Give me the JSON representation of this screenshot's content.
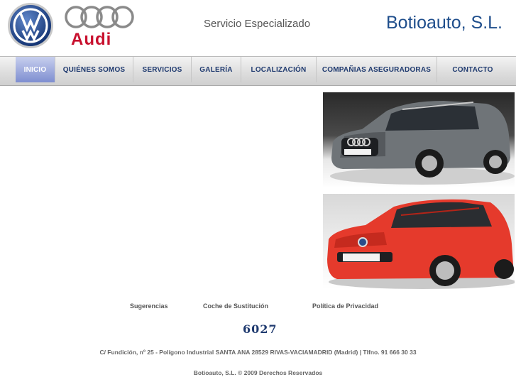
{
  "header": {
    "vw_logo": "vw-logo",
    "audi_logo_text": "Audi",
    "tagline": "Servicio Especializado",
    "brand": "Botioauto, S.L."
  },
  "nav": {
    "items": [
      {
        "label": "INICIO",
        "active": true
      },
      {
        "label": "QUIÉNES SOMOS",
        "active": false
      },
      {
        "label": "SERVICIOS",
        "active": false
      },
      {
        "label": "GALERÍA",
        "active": false
      },
      {
        "label": "LOCALIZACIÓN",
        "active": false
      },
      {
        "label": "COMPAÑIAS ASEGURADORAS",
        "active": false
      },
      {
        "label": "CONTACTO",
        "active": false
      }
    ]
  },
  "photos": {
    "top": "audi-car-photo",
    "bottom": "vw-car-photo"
  },
  "footer": {
    "links": {
      "sugerencias": "Sugerencias",
      "coche": "Coche de Sustitución",
      "privacidad": "Política de Privacidad"
    },
    "counter": "6027",
    "address": "C/ Fundición, nº 25 - Polígono Industrial SANTA ANA 28529 RIVAS-VACIAMADRID (Madrid) | Tlfno. 91 666 30 33",
    "copyright": "Botioauto, S.L. © 2009 Derechos Reservados"
  },
  "colors": {
    "brand_blue": "#1f4e8c",
    "audi_red": "#c8102e",
    "nav_active": "#7e8ed0"
  }
}
